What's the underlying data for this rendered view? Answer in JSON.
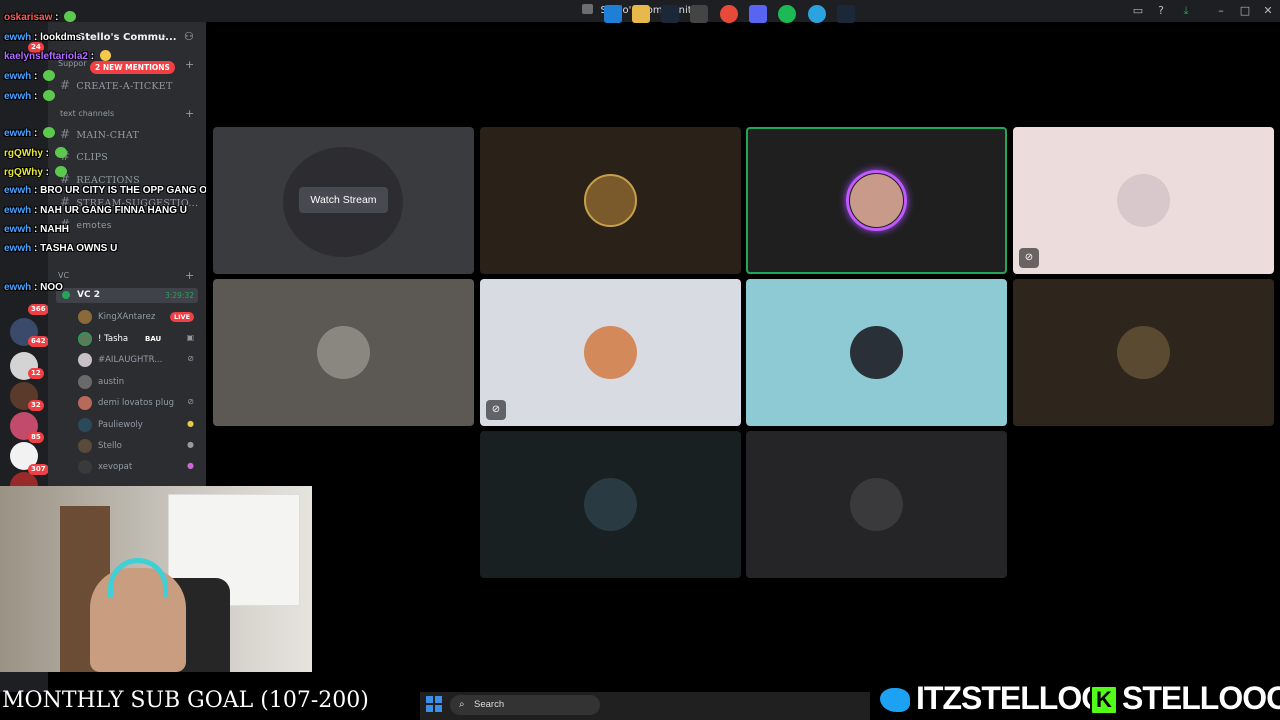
{
  "window": {
    "title": "Stello's Community"
  },
  "server": {
    "name": "Stello's Commu...",
    "mentions_pill": "2 NEW MENTIONS",
    "channels": [
      {
        "name": "CREATE-A-TICKET"
      },
      {
        "name": "MAIN-CHAT"
      },
      {
        "name": "CLIPS"
      },
      {
        "name": "REACTIONS"
      },
      {
        "name": "STREAM-SUGGESTIO..."
      },
      {
        "name": "emotes"
      }
    ],
    "categories": {
      "support": "Suppor",
      "text": "text channels",
      "vc": "VC"
    },
    "voice_channel": {
      "name": "VC 2",
      "time": "3:29:32"
    },
    "voice_users": [
      {
        "name": "KingXAntarez",
        "badge": "LIVE"
      },
      {
        "name": "! Tasha",
        "badge": "BAU"
      },
      {
        "name": "#AILAUGHTR..."
      },
      {
        "name": "austin"
      },
      {
        "name": "demi lovatos plug"
      },
      {
        "name": "Pauliewoly"
      },
      {
        "name": "Stello"
      },
      {
        "name": "xevopat"
      }
    ]
  },
  "rail_badges": [
    "24",
    "366",
    "642",
    "12",
    "32",
    "85",
    "307"
  ],
  "chat": [
    {
      "user": "oskarisaw",
      "msg": ""
    },
    {
      "user": "ewwh",
      "msg": "lookdms"
    },
    {
      "user": "kaelynsleftariola2",
      "msg": ""
    },
    {
      "user": "ewwh",
      "msg": ""
    },
    {
      "user": "ewwh",
      "msg": ""
    },
    {
      "user": "ewwh",
      "msg": ""
    },
    {
      "user": "rgQWhy",
      "msg": ""
    },
    {
      "user": "rgQWhy",
      "msg": ""
    },
    {
      "user": "ewwh",
      "msg": "BRO UR CITY IS THE OPP GANG OF RIO GG"
    },
    {
      "user": "ewwh",
      "msg": "NAH UR GANG FINNA HANG U"
    },
    {
      "user": "ewwh",
      "msg": "NAHH"
    },
    {
      "user": "ewwh",
      "msg": "TASHA OWNS U"
    },
    {
      "user": "ewwh",
      "msg": "NOO"
    }
  ],
  "stage": {
    "watch_stream": "Watch Stream"
  },
  "bottom": {
    "sub_goal": "MONTHLY SUB GOAL (107-200)",
    "search_placeholder": "Search",
    "twitter_handle": "ITZSTELLOO",
    "kick_handle": "STELLOOO",
    "kick_letter": "K"
  },
  "colors": {
    "accent_green": "#23a55a",
    "speaking_ring": "#c159ff",
    "mention_red": "#f23f43",
    "kick_green": "#53fc18",
    "twitter_blue": "#1da1f2"
  }
}
